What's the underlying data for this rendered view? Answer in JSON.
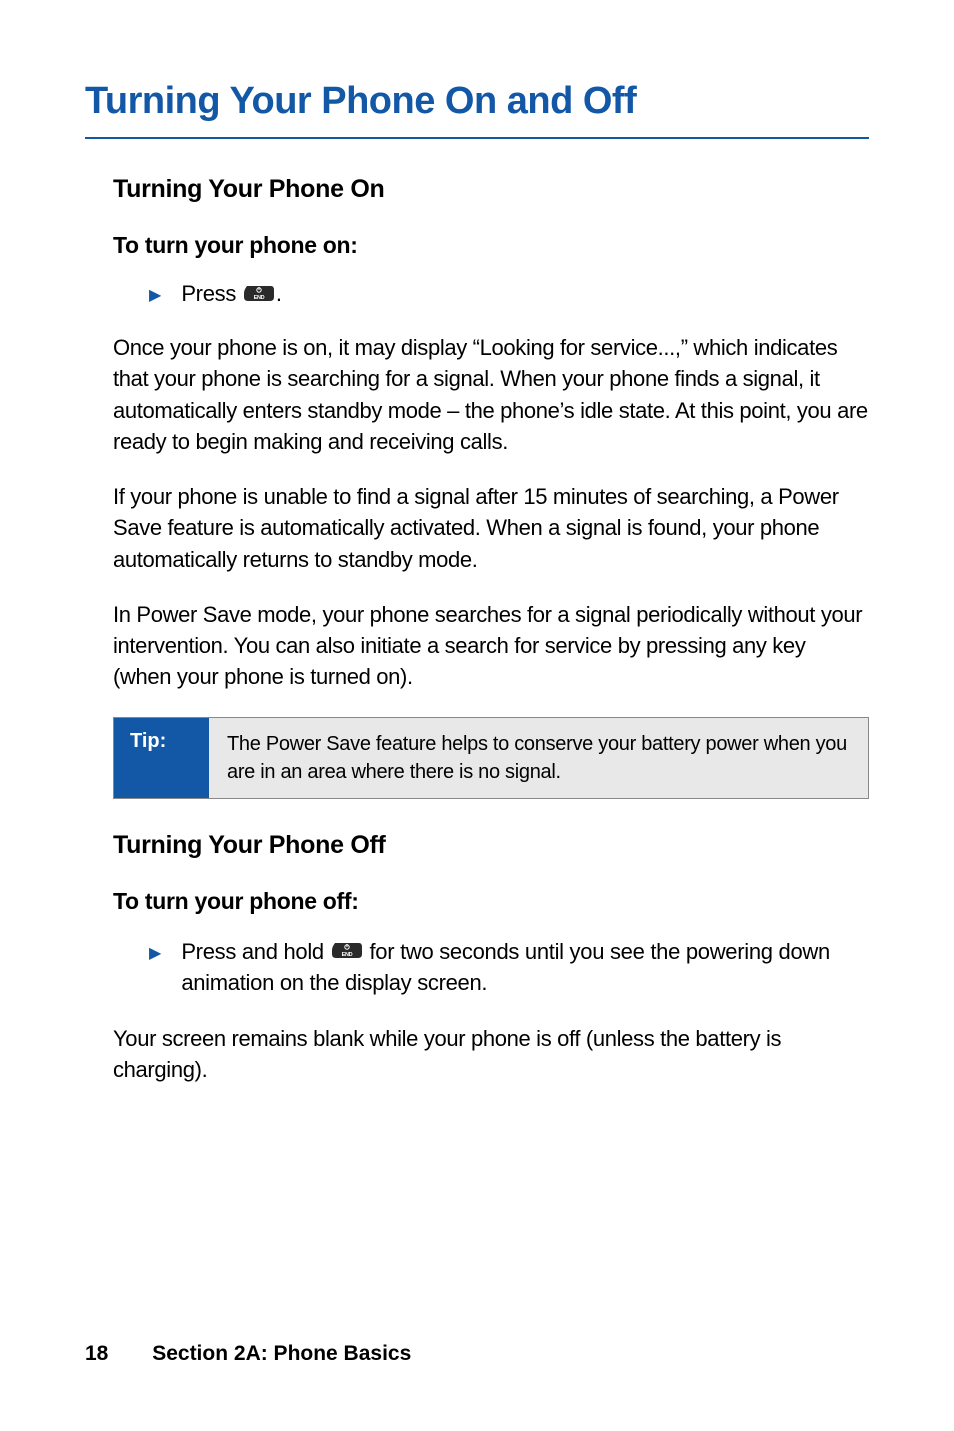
{
  "page_title": "Turning Your Phone On and Off",
  "section_on": {
    "heading": "Turning Your Phone On",
    "sub": "To turn your phone on:",
    "step_prefix": "Press ",
    "step_suffix": ".",
    "para1": "Once your phone is on, it may display “Looking for service...,” which indicates that your phone is searching for a signal. When your phone finds a signal, it automatically enters standby mode – the phone’s idle state. At this point, you are ready to begin making and receiving calls.",
    "para2": "If your phone is unable to find a signal after 15 minutes of searching, a Power Save feature is automatically activated. When a signal is found, your phone automatically returns to standby mode.",
    "para3": "In Power Save mode, your phone searches for a signal periodically without your intervention. You can also initiate a search for service by pressing any key (when your phone is turned on)."
  },
  "tip": {
    "label": "Tip:",
    "text": "The Power Save feature helps to conserve your battery power when you are in an area where there is no signal."
  },
  "section_off": {
    "heading": "Turning Your Phone Off",
    "sub": "To turn your phone off:",
    "step_prefix": "Press and hold ",
    "step_suffix": " for two seconds until you see the powering down animation on the display screen.",
    "para1": "Your screen remains blank while your phone is off (unless the battery is charging)."
  },
  "footer": {
    "page_number": "18",
    "section_label": "Section 2A: Phone Basics"
  }
}
